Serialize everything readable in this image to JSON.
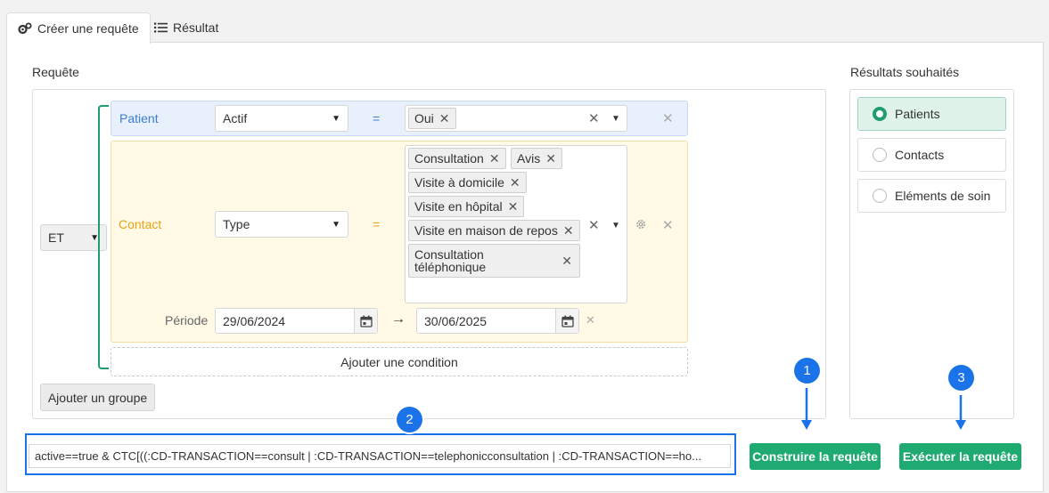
{
  "tabs": [
    {
      "label": "Créer une requête",
      "icon": "gears-icon",
      "active": true
    },
    {
      "label": "Résultat",
      "icon": "list-icon",
      "active": false
    }
  ],
  "query_section_label": "Requête",
  "results_section_label": "Résultats souhaités",
  "group_operator": "ET",
  "conditions": {
    "patient": {
      "label": "Patient",
      "field": "Actif",
      "operator": "=",
      "values": [
        "Oui"
      ]
    },
    "contact": {
      "label": "Contact",
      "field": "Type",
      "operator": "=",
      "values": [
        "Consultation",
        "Avis",
        "Visite à domicile",
        "Visite en hôpital",
        "Visite en maison de repos",
        "Consultation téléphonique"
      ],
      "period_label": "Période",
      "date_from": "29/06/2024",
      "date_arrow": "→",
      "date_to": "30/06/2025"
    }
  },
  "add_condition_label": "Ajouter une condition",
  "add_group_label": "Ajouter un groupe",
  "results_options": [
    {
      "label": "Patients",
      "selected": true
    },
    {
      "label": "Contacts",
      "selected": false
    },
    {
      "label": "Eléments de soin",
      "selected": false
    }
  ],
  "query_string": "active==true & CTC[((:CD-TRANSACTION==consult | :CD-TRANSACTION==telephonicconsultation | :CD-TRANSACTION==ho...",
  "buttons": {
    "build": "Construire la requête",
    "execute": "Exécuter la requête"
  },
  "annotations": [
    "1",
    "2",
    "3"
  ],
  "colors": {
    "primary_green": "#1faa71",
    "bracket_green": "#1e9d6e",
    "annotation_blue": "#1a73e8",
    "patient_label": "#3b7dd8",
    "contact_label": "#e8a317"
  }
}
